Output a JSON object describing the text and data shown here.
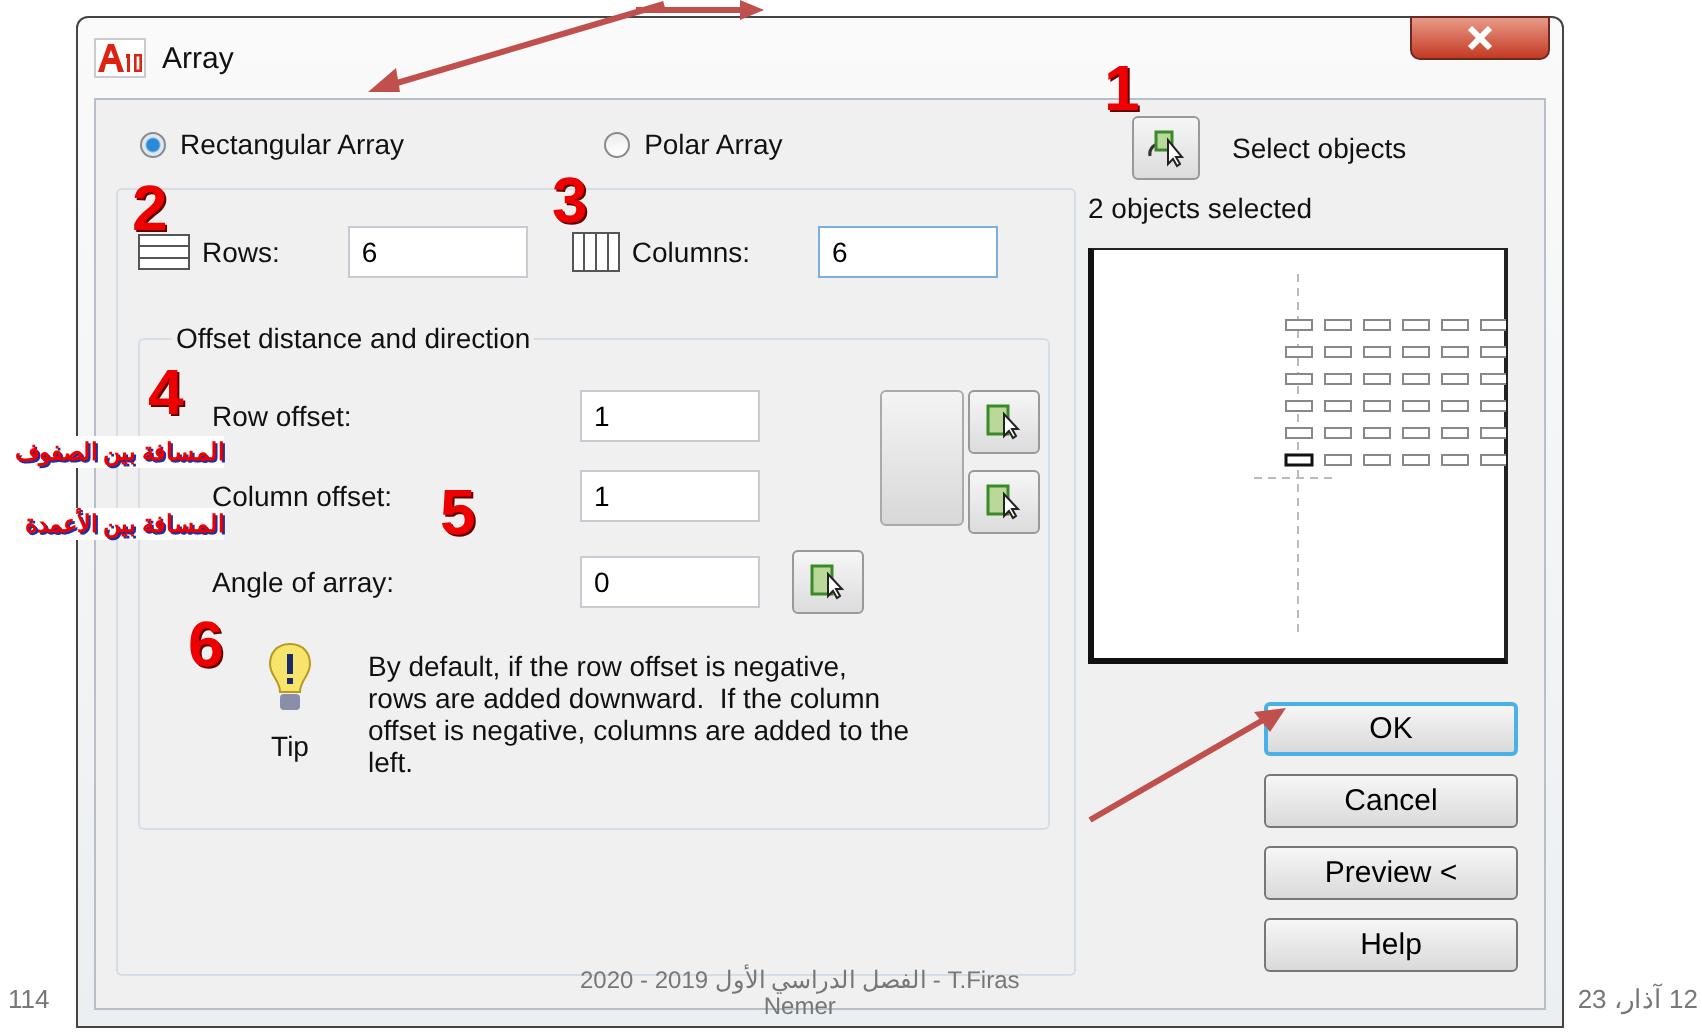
{
  "window": {
    "title": "Array"
  },
  "mode_options": [
    {
      "label": "Rectangular Array",
      "selected": true
    },
    {
      "label": "Polar Array",
      "selected": false
    }
  ],
  "rows": {
    "label": "Rows:",
    "value": "6",
    "focused": false
  },
  "columns": {
    "label": "Columns:",
    "value": "6",
    "focused": true
  },
  "offset_group": {
    "title": "Offset distance and direction",
    "fields": [
      {
        "label": "Row offset:",
        "value": "1"
      },
      {
        "label": "Column offset:",
        "value": "1"
      },
      {
        "label": "Angle of array:",
        "value": "0"
      }
    ]
  },
  "tip": {
    "label": "Tip",
    "text": "By default, if the row offset is negative, rows are added downward.  If the column offset is negative, columns are added to the left."
  },
  "selection": {
    "label": "Select objects",
    "status": "2 objects selected"
  },
  "buttons": [
    {
      "label": "OK",
      "default": true
    },
    {
      "label": "Cancel",
      "default": false
    },
    {
      "label": "Preview <",
      "default": false
    },
    {
      "label": "Help",
      "default": false
    }
  ],
  "annotations": {
    "numbers": [
      "1",
      "2",
      "3",
      "4",
      "5",
      "6"
    ],
    "notes": [
      "المسافة بين الصفوف",
      "المسافة بين الأعمدة"
    ]
  },
  "slide_footer": {
    "page": "114",
    "date": "12 آذار، 23",
    "center": "الفصل الدراسي الأول 2019 - 2020 - T.Firas",
    "center_line_2": "Nemer"
  }
}
